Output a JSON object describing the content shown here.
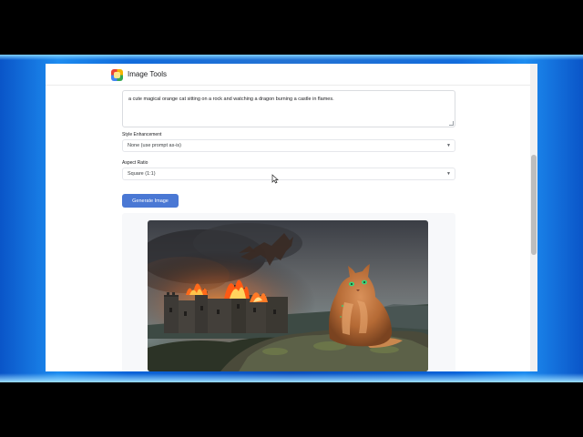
{
  "app": {
    "title": "Image Tools",
    "logo_icon": "image-tools-logo"
  },
  "form": {
    "prompt_value": "a cute magical orange cat sitting on a rock and watching a dragon burning a castle in flames.",
    "style_label": "Style Enhancement",
    "style_value": "None (use prompt as-is)",
    "aspect_label": "Aspect Ratio",
    "aspect_value": "Square (1:1)",
    "generate_label": "Generate Image"
  },
  "icons": {
    "dropdown": "chevron-down-icon",
    "cursor": "mouse-cursor-icon"
  },
  "colors": {
    "accent": "#4a78d4",
    "desktop": "#0a4fbf"
  }
}
